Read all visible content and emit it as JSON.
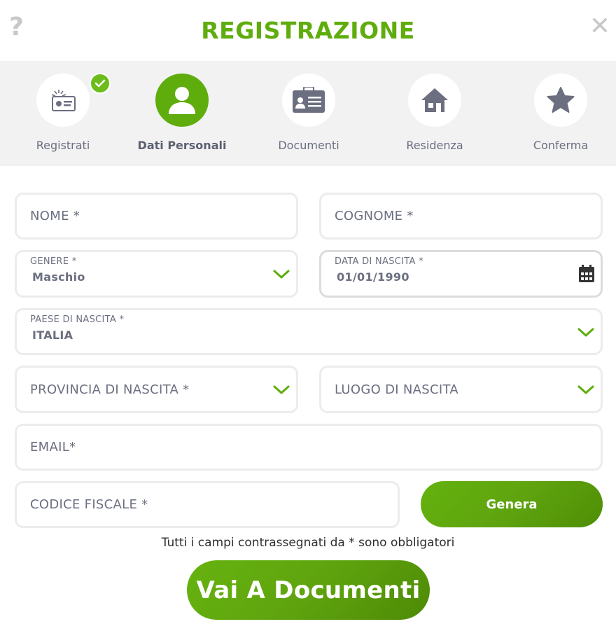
{
  "header": {
    "help_icon": "?",
    "title": "REGISTRAZIONE",
    "close_icon": "✕"
  },
  "steps": [
    {
      "label": "Registrati",
      "icon": "id-card-icon",
      "completed": true
    },
    {
      "label": "Dati Personali",
      "icon": "user-icon",
      "active": true
    },
    {
      "label": "Documenti",
      "icon": "badge-icon"
    },
    {
      "label": "Residenza",
      "icon": "home-icon"
    },
    {
      "label": "Conferma",
      "icon": "star-icon"
    }
  ],
  "form": {
    "nome_placeholder": "NOME *",
    "cognome_placeholder": "COGNOME *",
    "genere_label": "GENERE *",
    "genere_value": "Maschio",
    "data_label": "DATA DI NASCITA *",
    "data_value": "01/01/1990",
    "paese_label": "PAESE DI NASCITA *",
    "paese_value": "ITALIA",
    "provincia_placeholder": "PROVINCIA DI NASCITA *",
    "luogo_placeholder": "LUOGO DI NASCITA",
    "email_placeholder": "EMAIL*",
    "codice_placeholder": "CODICE FISCALE *",
    "genera_label": "Genera"
  },
  "note": "Tutti i campi contrassegnati da * sono obbligatori",
  "next_label": "Vai A Documenti",
  "colors": {
    "accent": "#5fad0d",
    "text": "#6b6f80",
    "step_bg": "#f2f2f2"
  }
}
